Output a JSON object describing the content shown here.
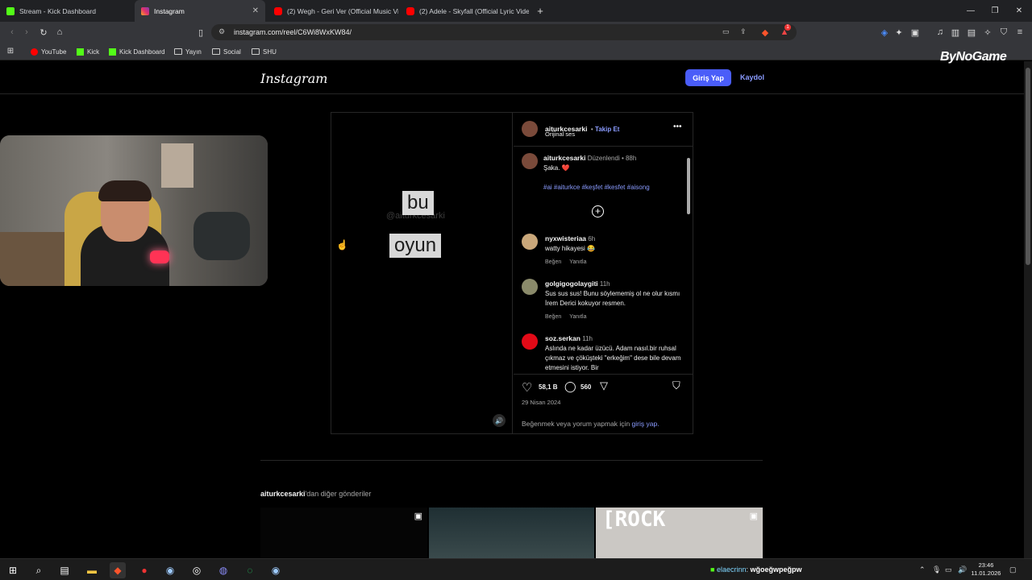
{
  "browser": {
    "tabs": [
      {
        "title": "Stream - Kick Dashboard",
        "color": "#53fc18"
      },
      {
        "title": "Instagram",
        "color": "#e1306c"
      },
      {
        "title": "(2) Wegh - Geri Ver (Official Music Vi",
        "color": "#ff0000"
      },
      {
        "title": "(2) Adele - Skyfall (Official Lyric Video",
        "color": "#ff0000"
      }
    ],
    "url": "instagram.com/reel/C6Wi8WxKW84/",
    "bookmarks": [
      {
        "label": "YouTube",
        "icon": "youtube-icon"
      },
      {
        "label": "Kick",
        "icon": "kick-icon"
      },
      {
        "label": "Kick Dashboard",
        "icon": "kick-icon"
      },
      {
        "label": "Yayın",
        "icon": "folder-icon"
      },
      {
        "label": "Social",
        "icon": "folder-icon"
      },
      {
        "label": "SHU",
        "icon": "folder-icon"
      }
    ],
    "notification_badge": "1"
  },
  "overlay": {
    "brand": "ByNoGame"
  },
  "instagram": {
    "logo": "Instagram",
    "login_label": "Giriş Yap",
    "signup_label": "Kaydol",
    "video": {
      "watermark": "@aiturkcesarki",
      "word1": "bu",
      "word2": "oyun"
    },
    "post": {
      "author": "aiturkcesarki",
      "follow": "Takip Et",
      "audio": "Orijinal ses",
      "caption_edited": "Düzenlendi",
      "caption_time": "88h",
      "caption_text": "Şaka. ❤️",
      "hashtags": "#ai #aiturkce #keşfet #kesfet #aisong",
      "likes": "58,1 B",
      "comments_count": "560",
      "date": "29 Nisan 2024",
      "login_prompt": "Beğenmek veya yorum yapmak için",
      "login_link": "giriş yap."
    },
    "comments": [
      {
        "user": "nyxwisteriaa",
        "time": "6h",
        "text": "watty hikayesi 😂",
        "like": "Beğen",
        "reply": "Yanıtla"
      },
      {
        "user": "golgigogolaygiti",
        "time": "11h",
        "text": "Sus sus sus! Bunu söylememiş ol ne olur kısmı İrem Derici kokuyor resmen.",
        "like": "Beğen",
        "reply": "Yanıtla"
      },
      {
        "user": "soz.serkan",
        "time": "11h",
        "text": "Aslında ne kadar üzücü. Adam nasıl.bir ruhsal çıkmaz ve çöküşteki \"erkeğim\" dese bile devam etmesini istiyor. Bir",
        "like": "",
        "reply": ""
      }
    ],
    "more_posts_user": "aiturkcesarki",
    "more_posts_suffix": "'dan diğer gönderiler",
    "thumb_text": "[ROCK"
  },
  "taskbar": {
    "chat_user": "elaecrinn",
    "chat_message": "wğoeğwpeğpw",
    "time": "23:46",
    "date": "11.01.2026"
  }
}
